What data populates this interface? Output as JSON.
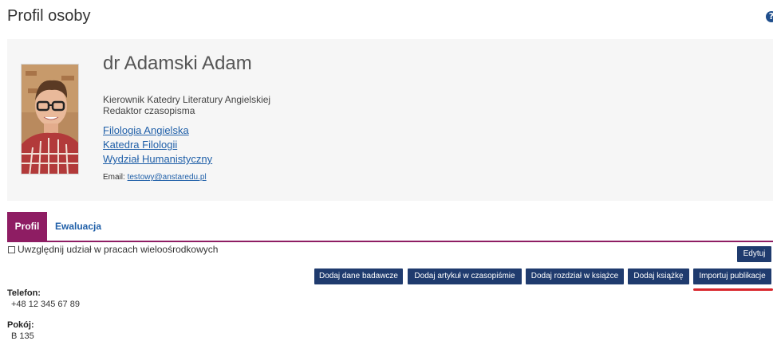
{
  "header": {
    "title": "Profil osoby",
    "help_icon": "question-circle-icon"
  },
  "profile": {
    "name": "dr Adamski Adam",
    "roles": [
      "Kierownik Katedry Literatury Angielskiej",
      "Redaktor czasopisma"
    ],
    "units": [
      "Filologia Angielska",
      "Katedra Filologii",
      "Wydział Humanistyczny"
    ],
    "email_label": "Email:",
    "email": "testowy@anstaredu.pl"
  },
  "tabs": [
    {
      "label": "Profil",
      "active": true
    },
    {
      "label": "Ewaluacja",
      "active": false
    }
  ],
  "options": {
    "multi_center_label": "Uwzględnij udział w pracach wieloośrodkowych",
    "multi_center_checked": false
  },
  "actions": {
    "edit_label": "Edytuj",
    "add_research_data": "Dodaj dane badawcze",
    "add_journal_article": "Dodaj artykuł w czasopiśmie",
    "add_book_chapter": "Dodaj rozdział w książce",
    "add_book": "Dodaj książkę",
    "import_publications": "Importuj publikacje"
  },
  "details": {
    "phone_label": "Telefon:",
    "phone": "+48 12 345 67 89",
    "room_label": "Pokój:",
    "room": "B 135"
  },
  "colors": {
    "accent": "#8e1d63",
    "button": "#1f3b6e",
    "link": "#1f5fa8",
    "highlight": "#d8262c"
  }
}
